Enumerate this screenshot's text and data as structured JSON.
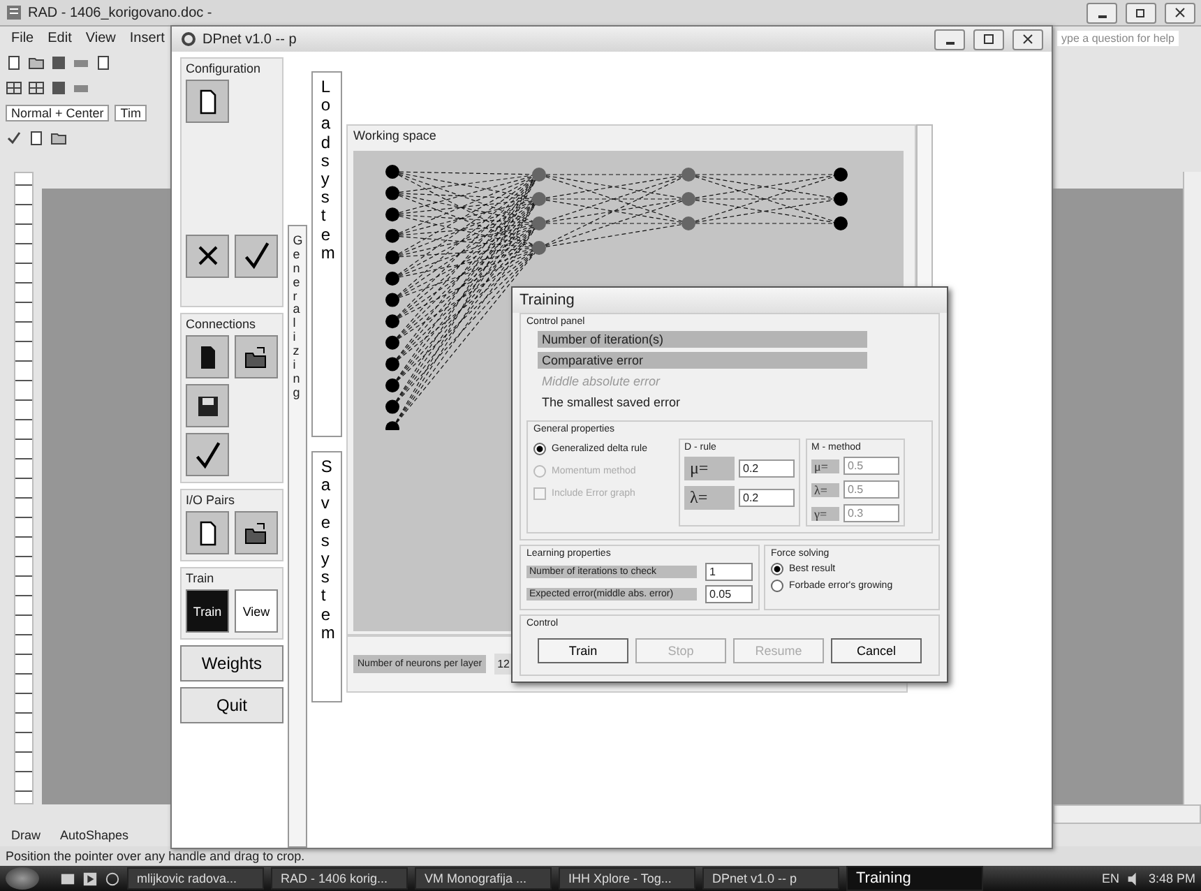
{
  "word": {
    "title": "RAD - 1406_korigovano.doc -",
    "menu": [
      "File",
      "Edit",
      "View",
      "Insert"
    ],
    "style_box": "Normal + Center",
    "font_box": "Tim",
    "help_box": "ype a question for help",
    "draw_toolbar": [
      "Draw",
      "AutoShapes"
    ],
    "status": "Position the pointer over any handle and drag to crop."
  },
  "dpnet": {
    "title": "DPnet v1.0  --  p",
    "groups": [
      {
        "title": "Configuration",
        "buttons": [
          {
            "kind": "new"
          },
          {
            "kind": "gap"
          },
          {
            "kind": "cancel"
          },
          {
            "kind": "ok"
          }
        ]
      },
      {
        "title": "Connections",
        "buttons": [
          {
            "kind": "document"
          },
          {
            "kind": "open"
          },
          {
            "kind": "save"
          },
          {
            "kind": "gap"
          },
          {
            "kind": "ok"
          }
        ]
      },
      {
        "title": "I/O Pairs",
        "buttons": [
          {
            "kind": "new"
          },
          {
            "kind": "open"
          }
        ]
      }
    ],
    "train_group": {
      "title": "Train",
      "buttons": [
        {
          "label": "Train",
          "selected": true
        },
        {
          "label": "View",
          "selected": false
        }
      ]
    },
    "weights": "Weights",
    "quit": "Quit",
    "side_label": "Generalizing",
    "system_tabs": [
      {
        "label": "Load system"
      },
      {
        "label": "Save system"
      }
    ],
    "working_space": "Working space",
    "neurons_label": "Number of neurons per layer",
    "neurons_value": "12"
  },
  "training": {
    "title": "Training",
    "control_panel": "Control panel",
    "stats": [
      {
        "label": "Number of iteration(s)",
        "highlighted": true,
        "disabled": false
      },
      {
        "label": "Comparative error",
        "highlighted": true,
        "disabled": false
      },
      {
        "label": "Middle absolute error",
        "highlighted": false,
        "disabled": true
      },
      {
        "label": "The smallest saved error",
        "highlighted": false,
        "disabled": false
      }
    ],
    "general_properties": "General properties",
    "options": [
      {
        "kind": "radio",
        "label": "Generalized delta rule",
        "selected": true,
        "disabled": false
      },
      {
        "kind": "radio",
        "label": "Momentum method",
        "selected": false,
        "disabled": true
      },
      {
        "kind": "checkbox",
        "label": "Include Error graph",
        "checked": false,
        "disabled": true
      }
    ],
    "d_rule": {
      "title": "D - rule",
      "disabled": false,
      "params": [
        {
          "symbol": "μ=",
          "value": "0.2"
        },
        {
          "symbol": "λ=",
          "value": "0.2"
        }
      ]
    },
    "m_method": {
      "title": "M - method",
      "disabled": true,
      "params": [
        {
          "symbol": "μ=",
          "value": "0.5"
        },
        {
          "symbol": "λ=",
          "value": "0.5"
        },
        {
          "symbol": "γ=",
          "value": "0.3"
        }
      ]
    },
    "learning_properties": "Learning properties",
    "learning": [
      {
        "label": "Number of iterations to check",
        "value": "1"
      },
      {
        "label": "Expected error(middle abs. error)",
        "value": "0.05"
      }
    ],
    "force_solving": "Force solving",
    "force": [
      {
        "label": "Best result",
        "selected": true
      },
      {
        "label": "Forbade error's growing",
        "selected": false
      }
    ],
    "control": "Control",
    "buttons": [
      {
        "label": "Train",
        "disabled": false
      },
      {
        "label": "Stop",
        "disabled": true
      },
      {
        "label": "Resume",
        "disabled": true
      },
      {
        "label": "Cancel",
        "disabled": false
      }
    ]
  },
  "taskbar": {
    "tasks": [
      {
        "label": "mlijkovic radova...",
        "selected": false
      },
      {
        "label": "RAD - 1406 korig...",
        "selected": false
      },
      {
        "label": "VM Monografija ...",
        "selected": false
      },
      {
        "label": "IHH Xplore - Tog...",
        "selected": false
      },
      {
        "label": "DPnet v1.0  --  p",
        "selected": false
      },
      {
        "label": "Training",
        "selected": true
      }
    ],
    "language": "EN",
    "clock": "3:48 PM"
  }
}
